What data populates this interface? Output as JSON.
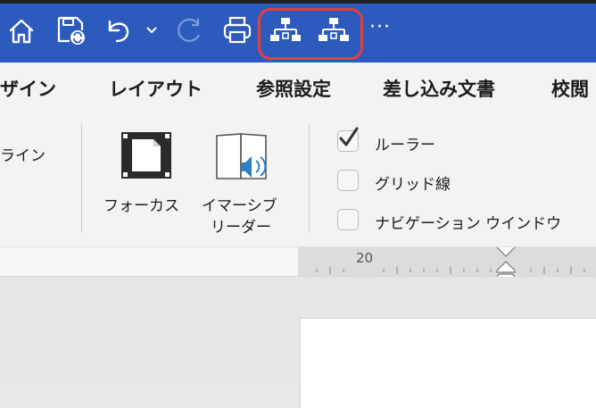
{
  "tabs": [
    "ザイン",
    "レイアウト",
    "参照設定",
    "差し込み文書",
    "校閲"
  ],
  "ribbon": {
    "partial_label": "ライン",
    "focus_label": "フォーカス",
    "immersive_label_line1": "イマーシブ",
    "immersive_label_line2": "リーダー",
    "show": [
      {
        "label": "ルーラー",
        "checked": true
      },
      {
        "label": "グリッド線",
        "checked": false
      },
      {
        "label": "ナビゲーション ウインドウ",
        "checked": false
      }
    ]
  },
  "ruler": {
    "marker": "20"
  },
  "quick_access": {
    "more_label": "···",
    "icons": [
      "home-icon",
      "save-icon",
      "undo-icon",
      "undo-dropdown-icon",
      "redo-icon",
      "print-icon",
      "org-chart-icon",
      "org-chart-icon",
      "more-icon"
    ]
  },
  "colors": {
    "titlebar": "#2d5bbd",
    "highlight": "#e04040",
    "ribbon": "#f3f3f3"
  }
}
